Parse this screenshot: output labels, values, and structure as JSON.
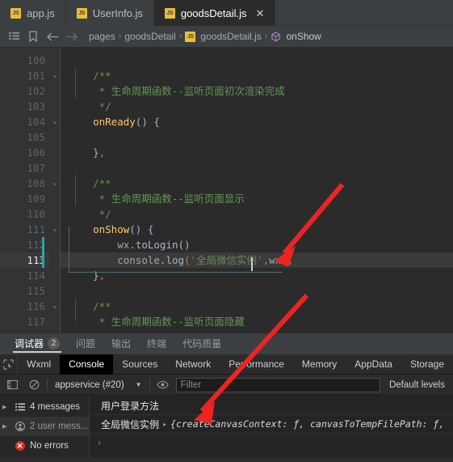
{
  "editor_tabs": [
    {
      "label": "app.js",
      "icon": "js-file-icon",
      "active": false,
      "closable": false
    },
    {
      "label": "UserInfo.js",
      "icon": "js-file-icon",
      "active": false,
      "closable": false
    },
    {
      "label": "goodsDetail.js",
      "icon": "js-file-icon",
      "active": true,
      "closable": true
    }
  ],
  "tab_close_glyph": "✕",
  "breadcrumb": {
    "icons": [
      "list-icon",
      "bookmark-icon",
      "back-arrow-icon",
      "forward-arrow-icon"
    ],
    "separator": "›",
    "items": [
      {
        "label": "pages",
        "icon": null
      },
      {
        "label": "goodsDetail",
        "icon": null
      },
      {
        "label": "goodsDetail.js",
        "icon": "js-file-icon"
      },
      {
        "label": "onShow",
        "icon": "method-cube-icon"
      }
    ]
  },
  "code": {
    "first_line_number": 100,
    "active_line": 113,
    "lines": [
      {
        "n": 100,
        "fold": false,
        "text": ""
      },
      {
        "n": 101,
        "fold": true,
        "text": "    /**"
      },
      {
        "n": 102,
        "fold": false,
        "text": "     * 生命周期函数--监听页面初次渲染完成"
      },
      {
        "n": 103,
        "fold": false,
        "text": "     */"
      },
      {
        "n": 104,
        "fold": true,
        "text": "    onReady() {"
      },
      {
        "n": 105,
        "fold": false,
        "text": ""
      },
      {
        "n": 106,
        "fold": false,
        "text": "    },"
      },
      {
        "n": 107,
        "fold": false,
        "text": ""
      },
      {
        "n": 108,
        "fold": true,
        "text": "    /**"
      },
      {
        "n": 109,
        "fold": false,
        "text": "     * 生命周期函数--监听页面显示"
      },
      {
        "n": 110,
        "fold": false,
        "text": "     */"
      },
      {
        "n": 111,
        "fold": true,
        "text": "    onShow() {"
      },
      {
        "n": 112,
        "fold": false,
        "text": "        wx.toLogin()"
      },
      {
        "n": 113,
        "fold": false,
        "text": "        console.log('全局微信实例',wx);"
      },
      {
        "n": 114,
        "fold": false,
        "text": "    },"
      },
      {
        "n": 115,
        "fold": false,
        "text": ""
      },
      {
        "n": 116,
        "fold": true,
        "text": "    /**"
      },
      {
        "n": 117,
        "fold": false,
        "text": "     * 生命周期函数--监听页面隐藏"
      }
    ],
    "tokens": {
      "comment_open": "/**",
      "comment_star": "*",
      "comment_close": "*/",
      "comment_ready": "生命周期函数--监听页面初次渲染完成",
      "comment_show": "生命周期函数--监听页面显示",
      "comment_hide": "生命周期函数--监听页面隐藏",
      "fn_onready": "onReady",
      "fn_onshow": "onShow",
      "obj_wx": "wx",
      "prop_tologin": "toLogin",
      "obj_console": "console",
      "prop_log": "log",
      "string_wxinstance": "'全局微信实例'",
      "arg_wx": "wx",
      "paren_open": "(",
      "paren_close": ")",
      "brace_open": "{",
      "brace_close": "}",
      "comma": ",",
      "semicolon": ";"
    },
    "fold_glyph": "⌄"
  },
  "panel_tabs": [
    {
      "label": "调试器",
      "badge": "2",
      "active": true
    },
    {
      "label": "问题",
      "badge": null,
      "active": false
    },
    {
      "label": "输出",
      "badge": null,
      "active": false
    },
    {
      "label": "终端",
      "badge": null,
      "active": false
    },
    {
      "label": "代码质量",
      "badge": null,
      "active": false
    }
  ],
  "devtools": {
    "tabs": [
      {
        "label": "Wxml",
        "active": false
      },
      {
        "label": "Console",
        "active": true
      },
      {
        "label": "Sources",
        "active": false
      },
      {
        "label": "Network",
        "active": false
      },
      {
        "label": "Performance",
        "active": false
      },
      {
        "label": "Memory",
        "active": false
      },
      {
        "label": "AppData",
        "active": false
      },
      {
        "label": "Storage",
        "active": false
      }
    ],
    "toolbar": {
      "context": "appservice (#20)",
      "context_arrow": "▼",
      "filter_placeholder": "Filter",
      "filter_value": "",
      "levels": "Default levels"
    },
    "console_sidebar": [
      {
        "label": "4 messages",
        "icon": "list-icon",
        "has_triangle": true,
        "selected": false
      },
      {
        "label": "2 user mess...",
        "icon": "user-icon",
        "has_triangle": true,
        "selected": true
      },
      {
        "label": "No errors",
        "icon": "error-circle-icon",
        "has_triangle": false,
        "selected": false
      }
    ],
    "console_messages": [
      {
        "text": "用户登录方法",
        "expandable": false,
        "object_preview": ""
      },
      {
        "text": "全局微信实例",
        "expandable": true,
        "object_preview": "{createCanvasContext: ƒ, canvasToTempFilePath: ƒ,"
      }
    ],
    "prompt_glyph": "›",
    "expand_glyph": "▸"
  },
  "annotations": {
    "arrow_color": "#ec2424",
    "arrows": [
      {
        "name": "arrow-to-console-log-line"
      },
      {
        "name": "arrow-to-console-output"
      }
    ]
  },
  "colors": {
    "editor_bg": "#2b2b2b",
    "gutter_bg": "#313335",
    "chrome_bg": "#3c3f41",
    "devtools_bg": "#242424",
    "accent_js": "#e8bf36",
    "change_bar": "#32a0a5",
    "error_red": "#d93025"
  }
}
